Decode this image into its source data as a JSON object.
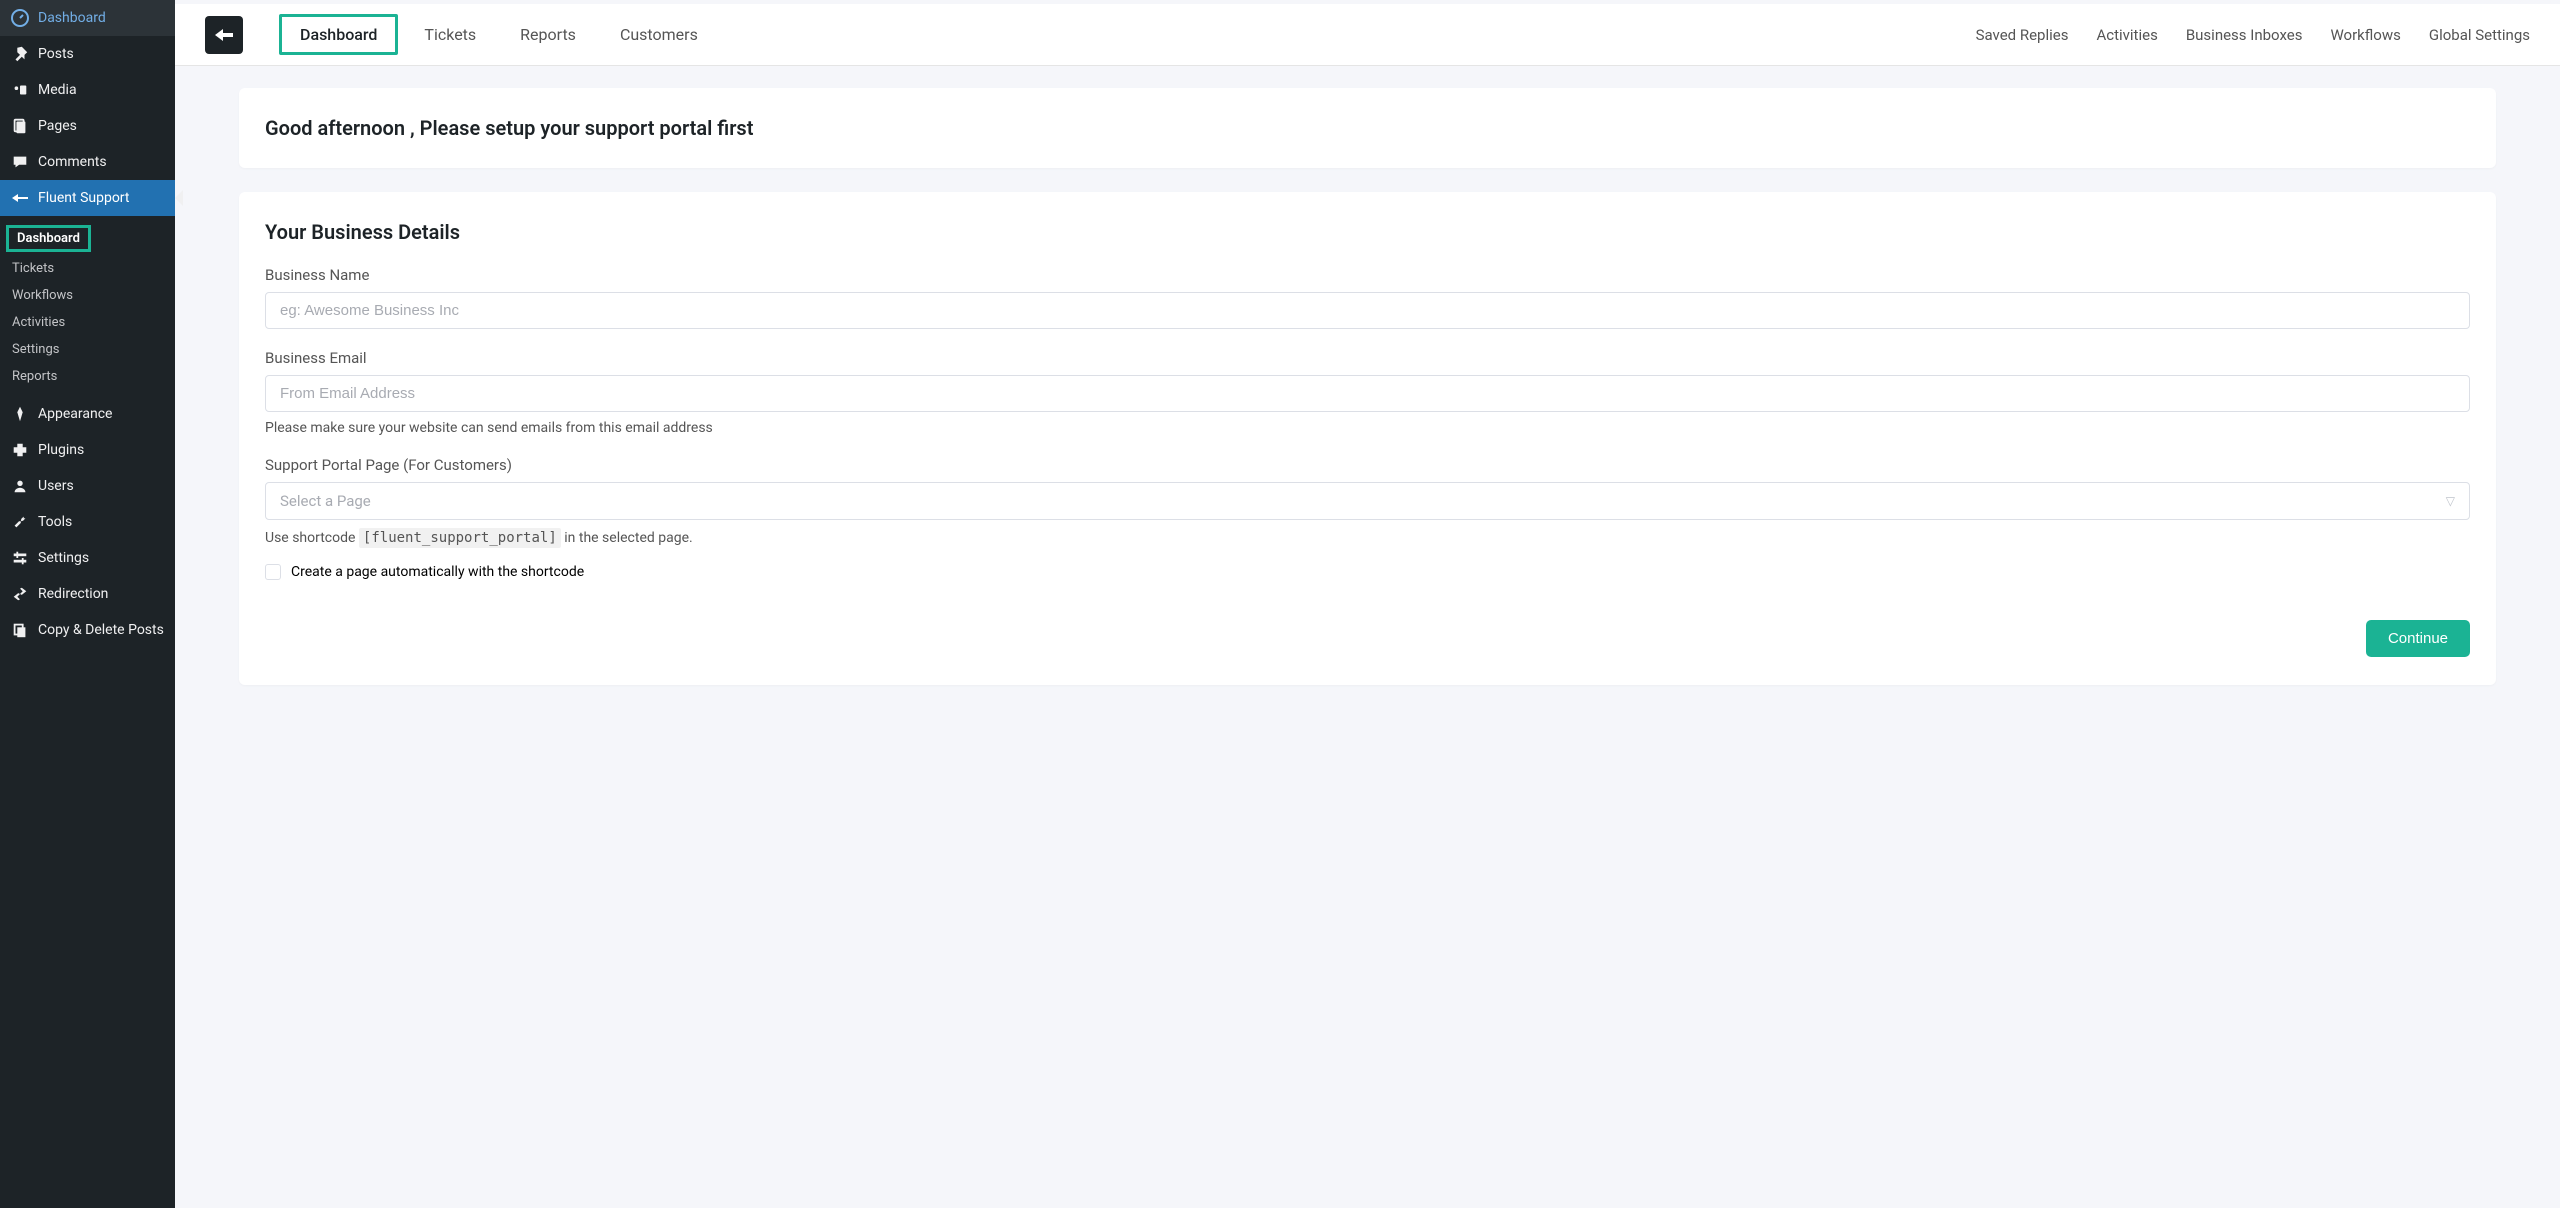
{
  "wp_sidebar": {
    "items": [
      {
        "label": "Dashboard",
        "icon": "dashboard"
      },
      {
        "label": "Posts",
        "icon": "pin"
      },
      {
        "label": "Media",
        "icon": "media"
      },
      {
        "label": "Pages",
        "icon": "pages"
      },
      {
        "label": "Comments",
        "icon": "comments"
      },
      {
        "label": "Fluent Support",
        "icon": "fluent",
        "active": true
      },
      {
        "label": "Appearance",
        "icon": "appearance"
      },
      {
        "label": "Plugins",
        "icon": "plugins"
      },
      {
        "label": "Users",
        "icon": "users"
      },
      {
        "label": "Tools",
        "icon": "tools"
      },
      {
        "label": "Settings",
        "icon": "settings"
      },
      {
        "label": "Redirection",
        "icon": "redirection"
      },
      {
        "label": "Copy & Delete Posts",
        "icon": "copy"
      }
    ],
    "submenu": [
      {
        "label": "Dashboard",
        "highlighted": true
      },
      {
        "label": "Tickets"
      },
      {
        "label": "Workflows"
      },
      {
        "label": "Activities"
      },
      {
        "label": "Settings"
      },
      {
        "label": "Reports"
      }
    ]
  },
  "top_nav": {
    "left": [
      {
        "label": "Dashboard",
        "active": true
      },
      {
        "label": "Tickets"
      },
      {
        "label": "Reports"
      },
      {
        "label": "Customers"
      }
    ],
    "right": [
      {
        "label": "Saved Replies"
      },
      {
        "label": "Activities"
      },
      {
        "label": "Business Inboxes"
      },
      {
        "label": "Workflows"
      },
      {
        "label": "Global Settings"
      }
    ]
  },
  "greeting": "Good afternoon , Please setup your support portal first",
  "form": {
    "title": "Your Business Details",
    "business_name": {
      "label": "Business Name",
      "placeholder": "eg: Awesome Business Inc"
    },
    "business_email": {
      "label": "Business Email",
      "placeholder": "From Email Address",
      "helper": "Please make sure your website can send emails from this email address"
    },
    "portal_page": {
      "label": "Support Portal Page (For Customers)",
      "placeholder": "Select a Page",
      "shortcode_pre": "Use shortcode",
      "shortcode": "[fluent_support_portal]",
      "shortcode_post": "in the selected page."
    },
    "auto_create": "Create a page automatically with the shortcode",
    "continue": "Continue"
  }
}
